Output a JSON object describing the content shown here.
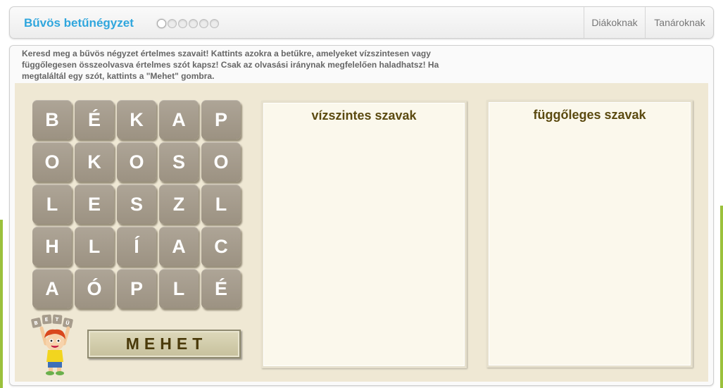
{
  "header": {
    "title": "Bűvös betűnégyzet",
    "progress": {
      "total": 6,
      "current": 1
    },
    "nav": {
      "students": "Diákoknak",
      "teachers": "Tanároknak"
    }
  },
  "instructions": "Keresd meg a bűvös négyzet értelmes szavait! Kattints azokra a betűkre, amelyeket vízszintesen vagy függőlegesen összeolvasva értelmes szót kapsz! Csak az olvasási iránynak megfelelően haladhatsz! Ha megtaláltál egy szót, kattints a \"Mehet\" gombra.",
  "grid": [
    [
      "B",
      "É",
      "K",
      "A",
      "P"
    ],
    [
      "O",
      "K",
      "O",
      "S",
      "O"
    ],
    [
      "L",
      "E",
      "S",
      "Z",
      "L"
    ],
    [
      "H",
      "L",
      "Í",
      "A",
      "C"
    ],
    [
      "A",
      "Ó",
      "P",
      "L",
      "É"
    ]
  ],
  "horizontal_words": {
    "title": "vízszintes szavak",
    "items": []
  },
  "vertical_words": {
    "title": "függőleges szavak",
    "items": []
  },
  "submit_label": "MEHET",
  "mascot_letters": [
    "B",
    "E",
    "T",
    "Ü"
  ],
  "colors": {
    "accent": "#2fa6dd",
    "tile": "#a69c8c",
    "board": "#efe8d4",
    "word_title": "#5b4a10"
  }
}
